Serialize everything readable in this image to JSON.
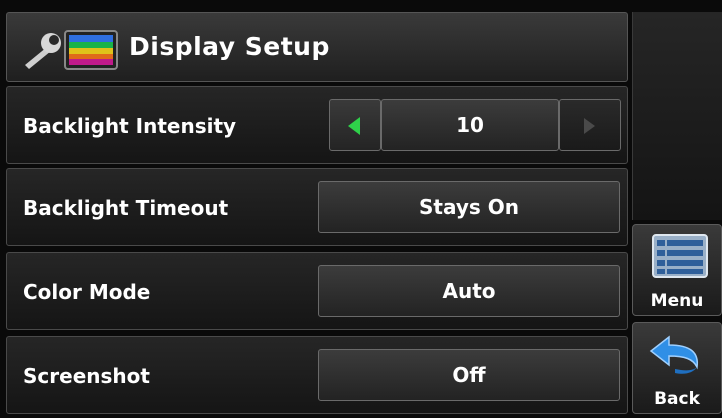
{
  "header": {
    "title": "Display Setup",
    "icon": "tools-display-icon"
  },
  "rows": [
    {
      "label": "Backlight Intensity",
      "control": "stepper",
      "value": "10"
    },
    {
      "label": "Backlight Timeout",
      "control": "button",
      "value": "Stays On"
    },
    {
      "label": "Color Mode",
      "control": "button",
      "value": "Auto"
    },
    {
      "label": "Screenshot",
      "control": "button",
      "value": "Off"
    }
  ],
  "side": {
    "menu_label": "Menu",
    "back_label": "Back"
  },
  "colors": {
    "accent_arrow": "#2fd14a",
    "back_arrow": "#2f8fe6",
    "background": "#0a0a0a"
  }
}
